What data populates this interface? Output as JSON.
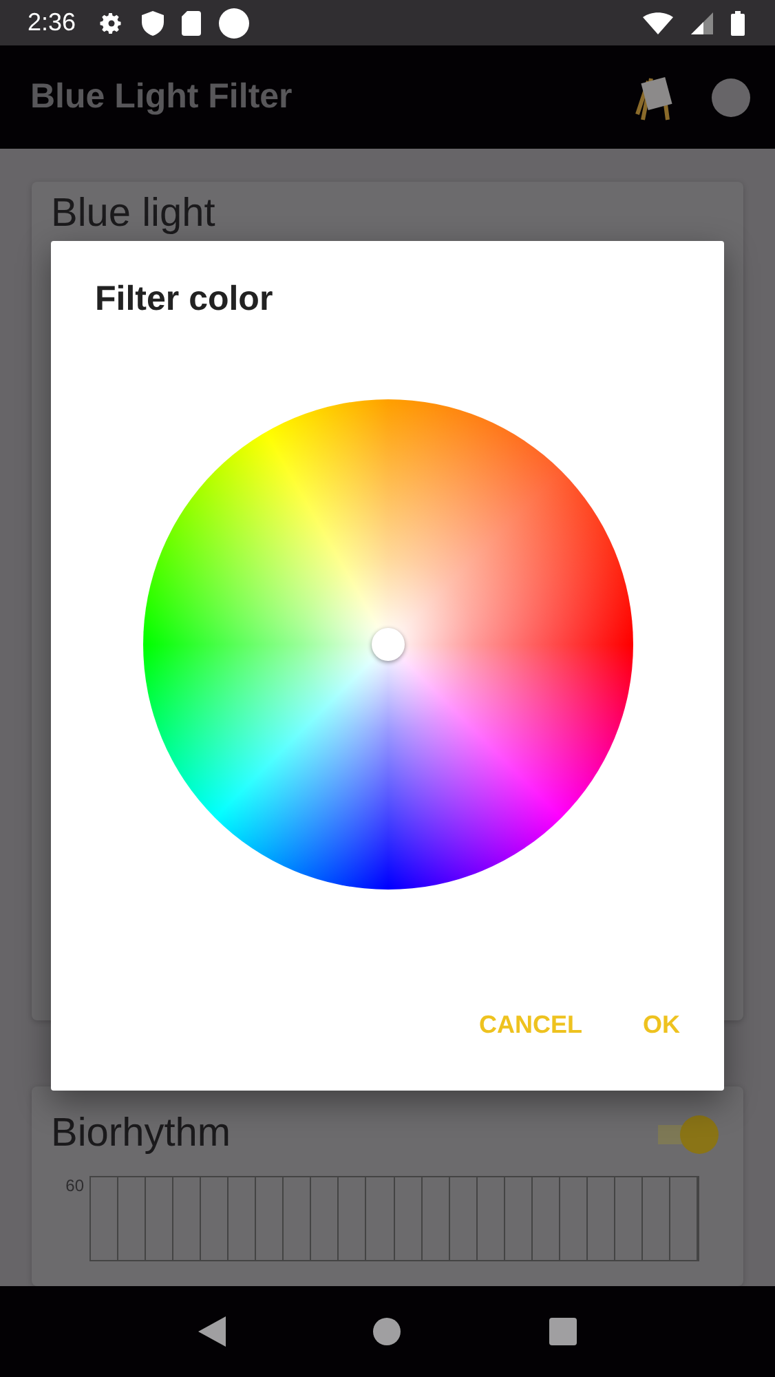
{
  "status_bar": {
    "time": "2:36"
  },
  "app_bar": {
    "title": "Blue Light Filter"
  },
  "cards": [
    {
      "title": "Blue light"
    },
    {
      "title": "Biorhythm",
      "toggle_on": true,
      "chart_axis_label": "60"
    }
  ],
  "dialog": {
    "title": "Filter color",
    "buttons": [
      "CANCEL",
      "OK"
    ]
  }
}
